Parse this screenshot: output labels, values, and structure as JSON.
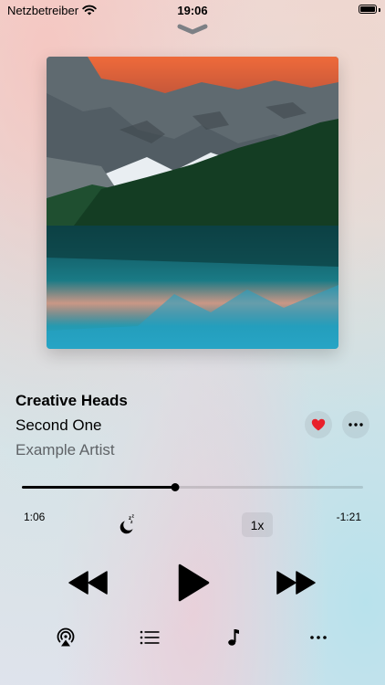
{
  "status_bar": {
    "carrier": "Netzbetreiber",
    "time": "19:06"
  },
  "now_playing": {
    "title": "Creative Heads",
    "subtitle": "Second One",
    "artist": "Example Artist",
    "favorite": true,
    "progress_fraction": 0.45
  },
  "timeline": {
    "elapsed": "1:06",
    "remaining": "-1:21"
  },
  "controls": {
    "speed_label": "1x"
  },
  "icons": {
    "grabber": "chevron-down-icon",
    "favorite": "heart-icon",
    "more": "ellipsis-icon",
    "sleep_timer": "moon-zzz-icon",
    "rewind": "backward-icon",
    "play": "play-icon",
    "forward": "forward-icon",
    "airplay": "airplay-icon",
    "queue": "list-icon",
    "lyrics": "music-note-icon",
    "bottom_more": "ellipsis-icon"
  },
  "colors": {
    "heart": "#e8202a",
    "secondary_text": "#5f6367"
  }
}
